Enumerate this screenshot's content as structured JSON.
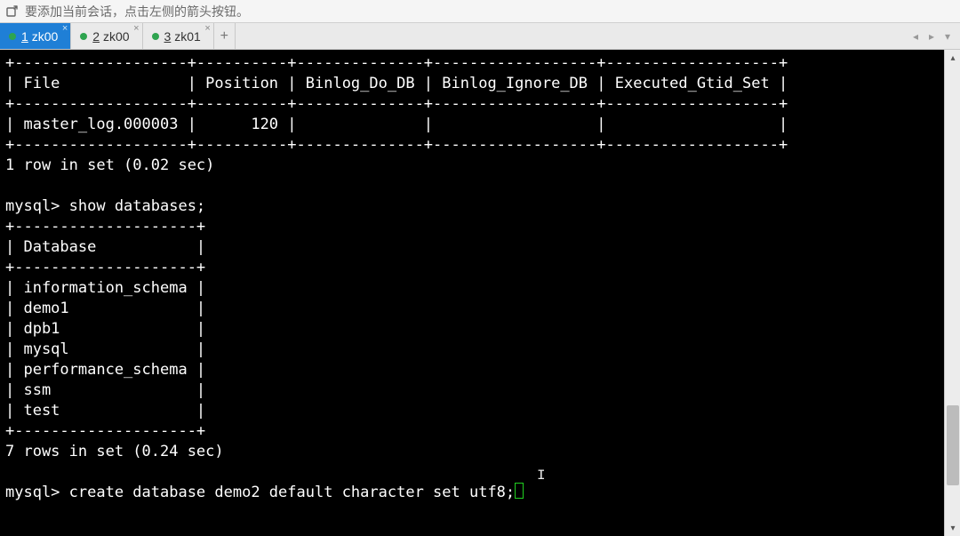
{
  "toolbar": {
    "hint_text": "要添加当前会话，点击左侧的箭头按钮。"
  },
  "tabs": [
    {
      "index": "1",
      "label": "zk00",
      "active": true
    },
    {
      "index": "2",
      "label": "zk00",
      "active": false
    },
    {
      "index": "3",
      "label": "zk01",
      "active": false
    }
  ],
  "tab_add_label": "+",
  "terminal": {
    "lines": [
      "+-------------------+----------+--------------+------------------+-------------------+",
      "| File              | Position | Binlog_Do_DB | Binlog_Ignore_DB | Executed_Gtid_Set |",
      "+-------------------+----------+--------------+------------------+-------------------+",
      "| master_log.000003 |      120 |              |                  |                   |",
      "+-------------------+----------+--------------+------------------+-------------------+",
      "1 row in set (0.02 sec)",
      "",
      "mysql> show databases;",
      "+--------------------+",
      "| Database           |",
      "+--------------------+",
      "| information_schema |",
      "| demo1              |",
      "| dpb1               |",
      "| mysql              |",
      "| performance_schema |",
      "| ssm                |",
      "| test               |",
      "+--------------------+",
      "7 rows in set (0.24 sec)",
      "",
      "mysql> create database demo2 default character set utf8;"
    ]
  }
}
